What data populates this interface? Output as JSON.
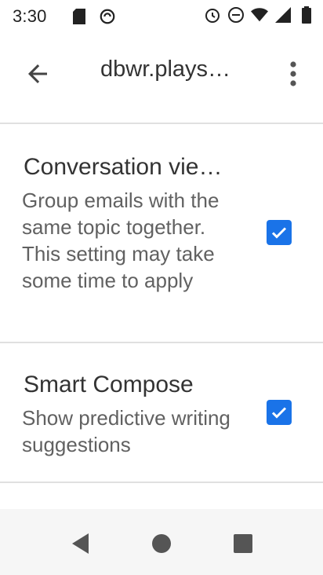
{
  "status_bar": {
    "time": "3:30",
    "left_icons": [
      "sd-card-icon",
      "sync-icon"
    ],
    "right_icons": [
      "alarm-icon",
      "do-not-disturb-icon",
      "wifi-icon",
      "signal-icon",
      "battery-icon"
    ]
  },
  "app_bar": {
    "title": "dbwr.plays…",
    "back_icon": "back-arrow-icon",
    "overflow_icon": "more-vert-icon"
  },
  "settings": [
    {
      "title": "Conversation vie…",
      "summary": "Group emails with the same topic together. This setting may take some time to apply",
      "checked": true
    },
    {
      "title": "Smart Compose",
      "summary": "Show predictive writing suggestions",
      "checked": true
    }
  ],
  "nav_bar": {
    "buttons": [
      "back-triangle-icon",
      "home-circle-icon",
      "recents-square-icon"
    ]
  },
  "colors": {
    "accent": "#1a73e8",
    "nav_bg": "#f6f6f6",
    "divider": "#e0e0e0"
  }
}
